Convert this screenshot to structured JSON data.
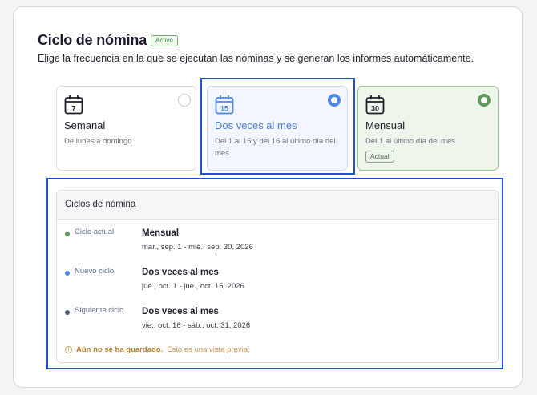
{
  "header": {
    "title": "Ciclo de nómina",
    "status_badge": "Activo",
    "subtitle": "Elige la frecuencia en la que se ejecutan las nóminas y se generan los informes automáticamente."
  },
  "options": [
    {
      "id": "weekly",
      "icon_number": "7",
      "name": "Semanal",
      "description": "De lunes a domingo",
      "selected": false,
      "current": false
    },
    {
      "id": "twice-monthly",
      "icon_number": "15",
      "name": "Dos veces al mes",
      "description": "Del 1 al 15 y del 16 al último día del mes",
      "selected": true,
      "current": false
    },
    {
      "id": "monthly",
      "icon_number": "30",
      "name": "Mensual",
      "description": "Del 1 al último día del mes",
      "selected": false,
      "current": true,
      "current_label": "Actual"
    }
  ],
  "cycles_panel": {
    "title": "Ciclos de nómina",
    "rows": [
      {
        "kind": "Ciclo actual",
        "dot_color": "#5c9a59",
        "name": "Mensual",
        "range": "mar., sep. 1 - mié., sep. 30, 2026"
      },
      {
        "kind": "Nuevo ciclo",
        "dot_color": "#4d87ee",
        "name": "Dos veces al mes",
        "range": "jue., oct. 1 - jue., oct. 15, 2026"
      },
      {
        "kind": "Siguiente ciclo",
        "dot_color": "#4a5a7a",
        "name": "Dos veces al mes",
        "range": "vie., oct. 16 - sáb., oct. 31, 2026"
      }
    ],
    "warning": {
      "icon": "info-icon",
      "strong": "Aún no se ha guardado.",
      "text": "Esto es una vista previa."
    }
  },
  "colors": {
    "accent_blue": "#4d87ee",
    "selection_outline": "#1d4fd8",
    "current_green": "#5c9a59"
  }
}
